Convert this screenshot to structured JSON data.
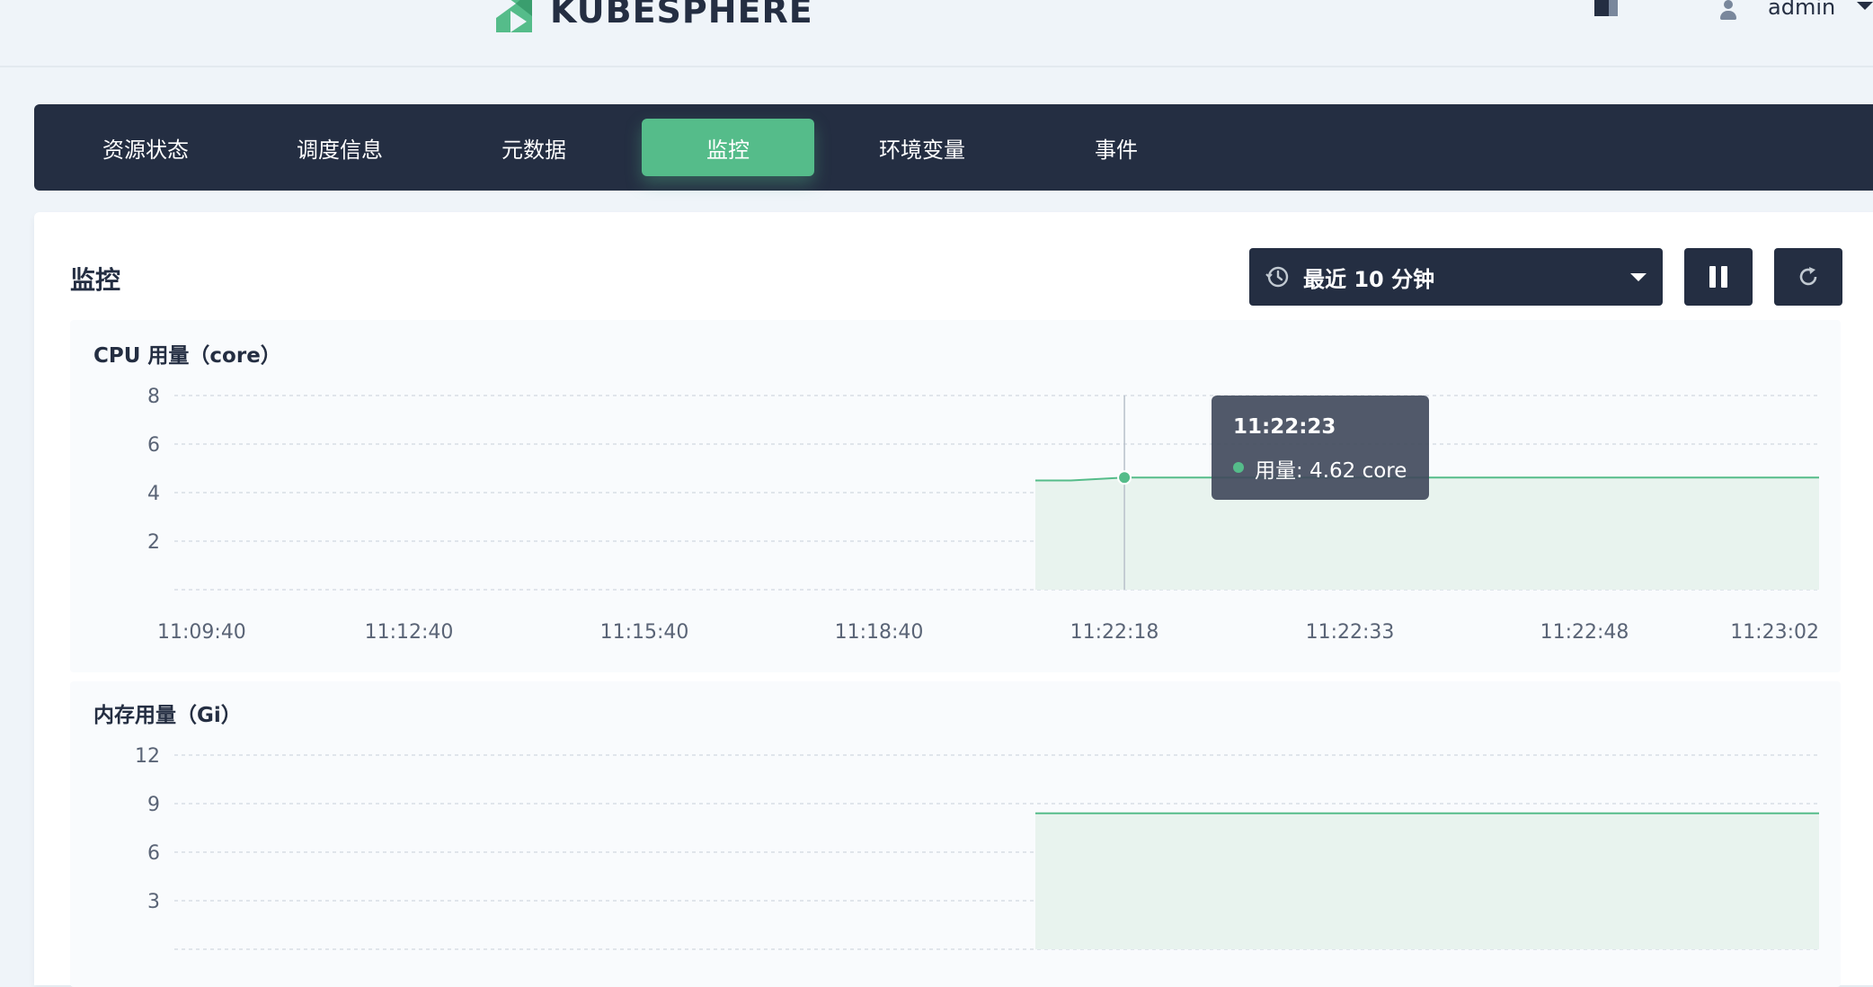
{
  "header": {
    "logo_text": "KUBESPHERE",
    "username": "admin"
  },
  "tabs": [
    {
      "label": "资源状态"
    },
    {
      "label": "调度信息"
    },
    {
      "label": "元数据"
    },
    {
      "label": "监控",
      "active": true
    },
    {
      "label": "环境变量"
    },
    {
      "label": "事件"
    }
  ],
  "monitoring": {
    "title": "监控",
    "time_range": "最近 10 分钟",
    "pause_icon": "pause-icon",
    "refresh_icon": "refresh-icon",
    "clock_icon": "history-clock-icon"
  },
  "colors": {
    "accent": "#55bc8a",
    "dark": "#242e42",
    "fill": "#e8f3ee"
  },
  "tooltip": {
    "time": "11:22:23",
    "label": "用量: 4.62 core"
  },
  "chart_data": [
    {
      "type": "area",
      "title": "CPU 用量（core）",
      "x_tick_labels": [
        "11:09:40",
        "11:12:40",
        "11:15:40",
        "11:18:40",
        "11:22:18",
        "11:22:33",
        "11:22:48",
        "11:23:02"
      ],
      "y_ticks": [
        2,
        4,
        6,
        8
      ],
      "ylim": [
        0,
        8
      ],
      "grid": true,
      "series": [
        {
          "values": [
            {
              "x": "11:22:18",
              "y": 4.5
            },
            {
              "x": "11:22:20",
              "y": 4.5
            },
            {
              "x": "11:22:23",
              "y": 4.62
            },
            {
              "x": "11:22:33",
              "y": 4.62
            },
            {
              "x": "11:22:48",
              "y": 4.62
            },
            {
              "x": "11:23:02",
              "y": 4.62
            }
          ]
        }
      ]
    },
    {
      "type": "area",
      "title": "内存用量（Gi）",
      "x_tick_labels": [],
      "y_ticks": [
        3,
        6,
        9,
        12
      ],
      "ylim": [
        0,
        12
      ],
      "grid": true,
      "series": [
        {
          "values": [
            {
              "x": "11:22:18",
              "y": 8.4
            },
            {
              "x": "11:22:33",
              "y": 8.4
            },
            {
              "x": "11:22:48",
              "y": 8.4
            },
            {
              "x": "11:23:02",
              "y": 8.4
            }
          ]
        }
      ]
    }
  ]
}
